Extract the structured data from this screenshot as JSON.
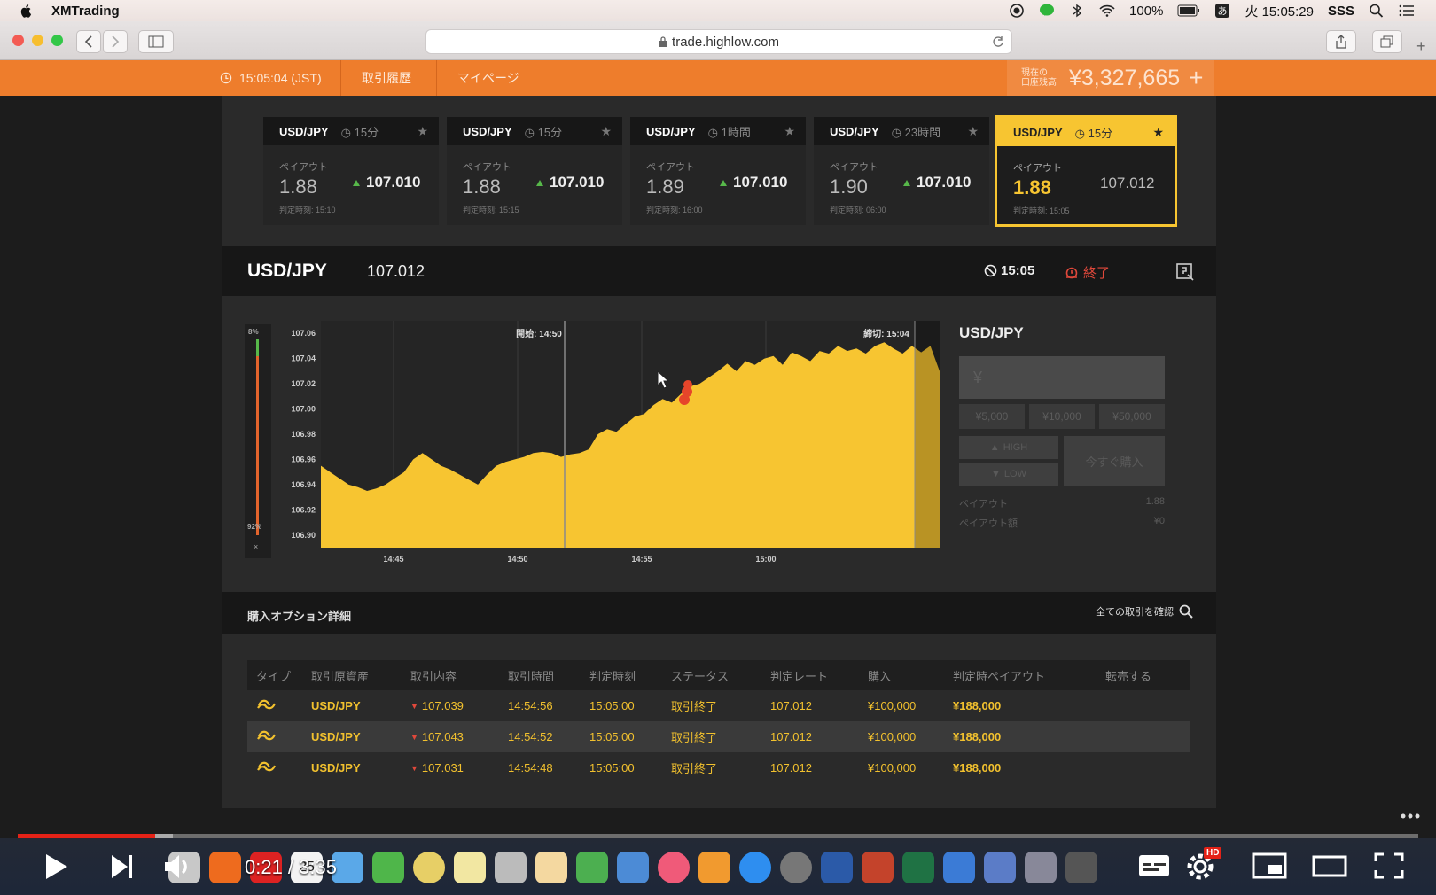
{
  "menubar": {
    "app_name": "XMTrading",
    "battery": "100%",
    "clock": "火 15:05:29",
    "user": "SSS"
  },
  "browser": {
    "url": "trade.highlow.com"
  },
  "nav": {
    "time": "15:05:04 (JST)",
    "history": "取引履歴",
    "mypage": "マイページ",
    "balance_label_1": "現在の",
    "balance_label_2": "口座残高",
    "balance": "¥3,327,665",
    "plus": "+"
  },
  "cards": [
    {
      "symbol": "USD/JPY",
      "duration": "15分",
      "payout_label": "ペイアウト",
      "payout": "1.88",
      "rate": "107.010",
      "expiry": "判定時刻: 15:10"
    },
    {
      "symbol": "USD/JPY",
      "duration": "15分",
      "payout_label": "ペイアウト",
      "payout": "1.88",
      "rate": "107.010",
      "expiry": "判定時刻: 15:15"
    },
    {
      "symbol": "USD/JPY",
      "duration": "1時間",
      "payout_label": "ペイアウト",
      "payout": "1.89",
      "rate": "107.010",
      "expiry": "判定時刻: 16:00"
    },
    {
      "symbol": "USD/JPY",
      "duration": "23時間",
      "payout_label": "ペイアウト",
      "payout": "1.90",
      "rate": "107.010",
      "expiry": "判定時刻: 06:00"
    },
    {
      "symbol": "USD/JPY",
      "duration": "15分",
      "payout_label": "ペイアウト",
      "payout": "1.88",
      "rate": "107.012",
      "expiry": "判定時刻: 15:05"
    }
  ],
  "asset": {
    "symbol": "USD/JPY",
    "price": "107.012",
    "time": "15:05",
    "status": "終了"
  },
  "sentiment": {
    "high_pct": "8%",
    "low_pct": "92%",
    "close": "×"
  },
  "chart_data": {
    "type": "area",
    "start_label": "開始: 14:50",
    "close_label": "締切: 15:04",
    "x_ticks": [
      "14:45",
      "14:50",
      "14:55",
      "15:00"
    ],
    "y_ticks": [
      "107.06",
      "107.04",
      "107.02",
      "107.00",
      "106.98",
      "106.96",
      "106.94",
      "106.92",
      "106.90"
    ],
    "ylim": [
      106.89,
      107.07
    ],
    "series": [
      {
        "values": [
          106.955,
          106.95,
          106.945,
          106.94,
          106.938,
          106.935,
          106.937,
          106.94,
          106.945,
          106.95,
          106.96,
          106.965,
          106.96,
          106.955,
          106.952,
          106.948,
          106.944,
          106.94,
          106.948,
          106.955,
          106.958,
          106.96,
          106.962,
          106.965,
          106.966,
          106.965,
          106.962,
          106.964,
          106.965,
          106.968,
          106.98,
          106.984,
          106.982,
          106.988,
          106.994,
          106.996,
          107.003,
          107.008,
          107.005,
          107.012,
          107.018,
          107.02,
          107.025,
          107.03,
          107.036,
          107.03,
          107.038,
          107.035,
          107.04,
          107.042,
          107.035,
          107.045,
          107.042,
          107.038,
          107.046,
          107.044,
          107.05,
          107.046,
          107.048,
          107.044,
          107.05,
          107.053,
          107.048,
          107.044,
          107.05,
          107.045,
          107.05,
          107.03
        ]
      }
    ],
    "fill_color": "#f7c531",
    "grid": true
  },
  "panel": {
    "title": "USD/JPY",
    "amount_placeholder": "¥",
    "amounts": [
      "¥5,000",
      "¥10,000",
      "¥50,000"
    ],
    "high": "HIGH",
    "low": "LOW",
    "buy_now": "今すぐ購入",
    "payout_label": "ペイアウト",
    "payout_value": "1.88",
    "payout_amount_label": "ペイアウト額",
    "payout_amount_value": "¥0"
  },
  "details": {
    "title": "購入オプション詳細",
    "all_trades": "全ての取引を確認",
    "columns": [
      "タイプ",
      "取引原資産",
      "取引内容",
      "取引時間",
      "判定時刻",
      "ステータス",
      "判定レート",
      "購入",
      "判定時ペイアウト",
      "転売する"
    ],
    "rows": [
      {
        "asset": "USD/JPY",
        "strike": "107.039",
        "trade_time": "14:54:56",
        "expiry": "15:05:00",
        "status": "取引終了",
        "rate": "107.012",
        "purchase": "¥100,000",
        "payout": "¥188,000"
      },
      {
        "asset": "USD/JPY",
        "strike": "107.043",
        "trade_time": "14:54:52",
        "expiry": "15:05:00",
        "status": "取引終了",
        "rate": "107.012",
        "purchase": "¥100,000",
        "payout": "¥188,000"
      },
      {
        "asset": "USD/JPY",
        "strike": "107.031",
        "trade_time": "14:54:48",
        "expiry": "15:05:00",
        "status": "取引終了",
        "rate": "107.012",
        "purchase": "¥100,000",
        "payout": "¥188,000"
      }
    ]
  },
  "player": {
    "time": "0:21 / 3:35",
    "dock_date": "25",
    "hd_badge": "HD"
  }
}
